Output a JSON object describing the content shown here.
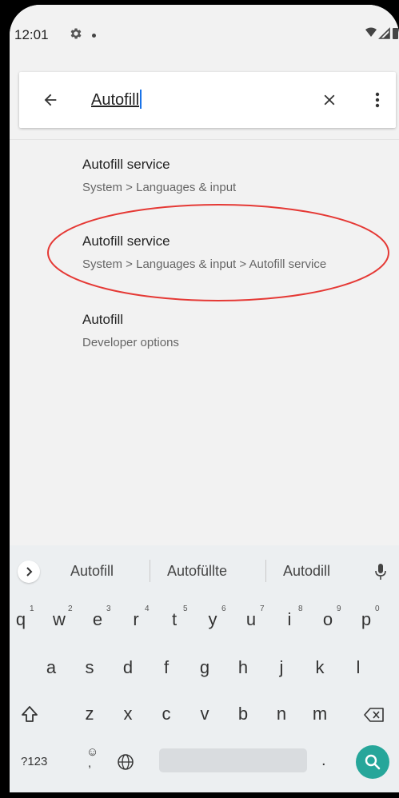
{
  "status_bar": {
    "time": "12:01"
  },
  "search": {
    "query": "Autofill"
  },
  "results": [
    {
      "title": "Autofill service",
      "subtitle": "System > Languages & input"
    },
    {
      "title": "Autofill service",
      "subtitle": "System > Languages & input > Autofill service"
    },
    {
      "title": "Autofill",
      "subtitle": "Developer options"
    }
  ],
  "keyboard": {
    "suggestions": [
      "Autofill",
      "Autofüllte",
      "Autodill"
    ],
    "row1_keys": [
      "q",
      "w",
      "e",
      "r",
      "t",
      "y",
      "u",
      "i",
      "o",
      "p"
    ],
    "row1_hints": [
      "1",
      "2",
      "3",
      "4",
      "5",
      "6",
      "7",
      "8",
      "9",
      "0"
    ],
    "row2_keys": [
      "a",
      "s",
      "d",
      "f",
      "g",
      "h",
      "j",
      "k",
      "l"
    ],
    "row3_keys": [
      "z",
      "x",
      "c",
      "v",
      "b",
      "n",
      "m"
    ],
    "symbols_key": "?123",
    "comma_key": ",",
    "period_key": ".",
    "accent_color": "#26a69a"
  },
  "highlight": {
    "color": "#e53935"
  }
}
